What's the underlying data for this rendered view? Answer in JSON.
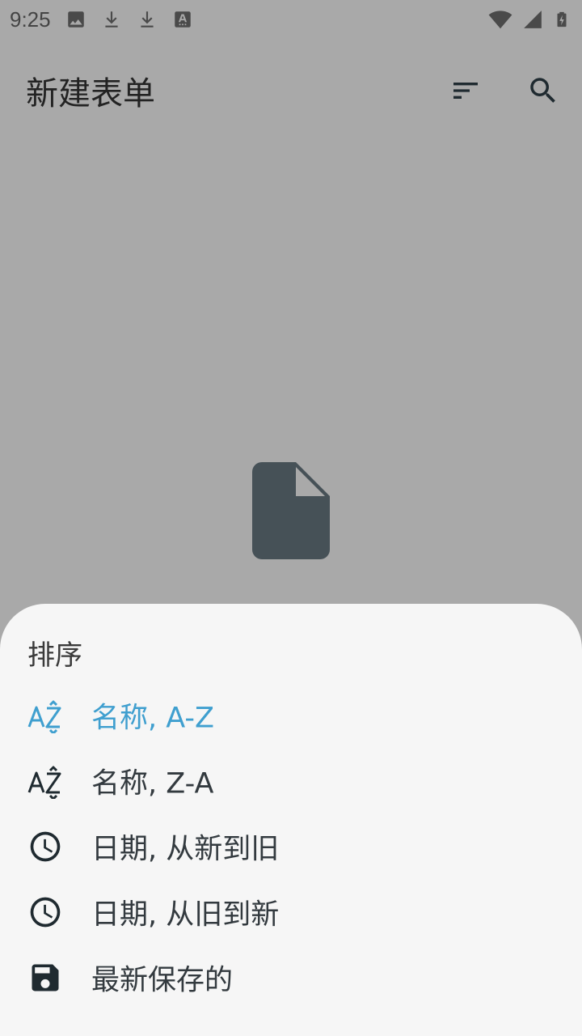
{
  "status_bar": {
    "time": "9:25",
    "left_icons": [
      "image-icon",
      "download-icon",
      "download-icon",
      "keyboard-a-icon"
    ],
    "right_icons": [
      "wifi-icon",
      "signal-icon",
      "battery-charging-icon"
    ]
  },
  "app_bar": {
    "title": "新建表单",
    "actions": [
      "sort-icon",
      "search-icon"
    ]
  },
  "empty_state": {
    "icon": "file-icon",
    "icon_color": "#465157"
  },
  "sort_sheet": {
    "title": "排序",
    "selected_color": "#3f9fcf",
    "options": [
      {
        "label": "名称, A-Z",
        "icon": "sort-az-icon",
        "selected": true
      },
      {
        "label": "名称, Z-A",
        "icon": "sort-za-icon",
        "selected": false
      },
      {
        "label": "日期, 从新到旧",
        "icon": "clock-icon",
        "selected": false
      },
      {
        "label": "日期, 从旧到新",
        "icon": "clock-icon",
        "selected": false
      },
      {
        "label": "最新保存的",
        "icon": "save-icon",
        "selected": false
      }
    ]
  }
}
